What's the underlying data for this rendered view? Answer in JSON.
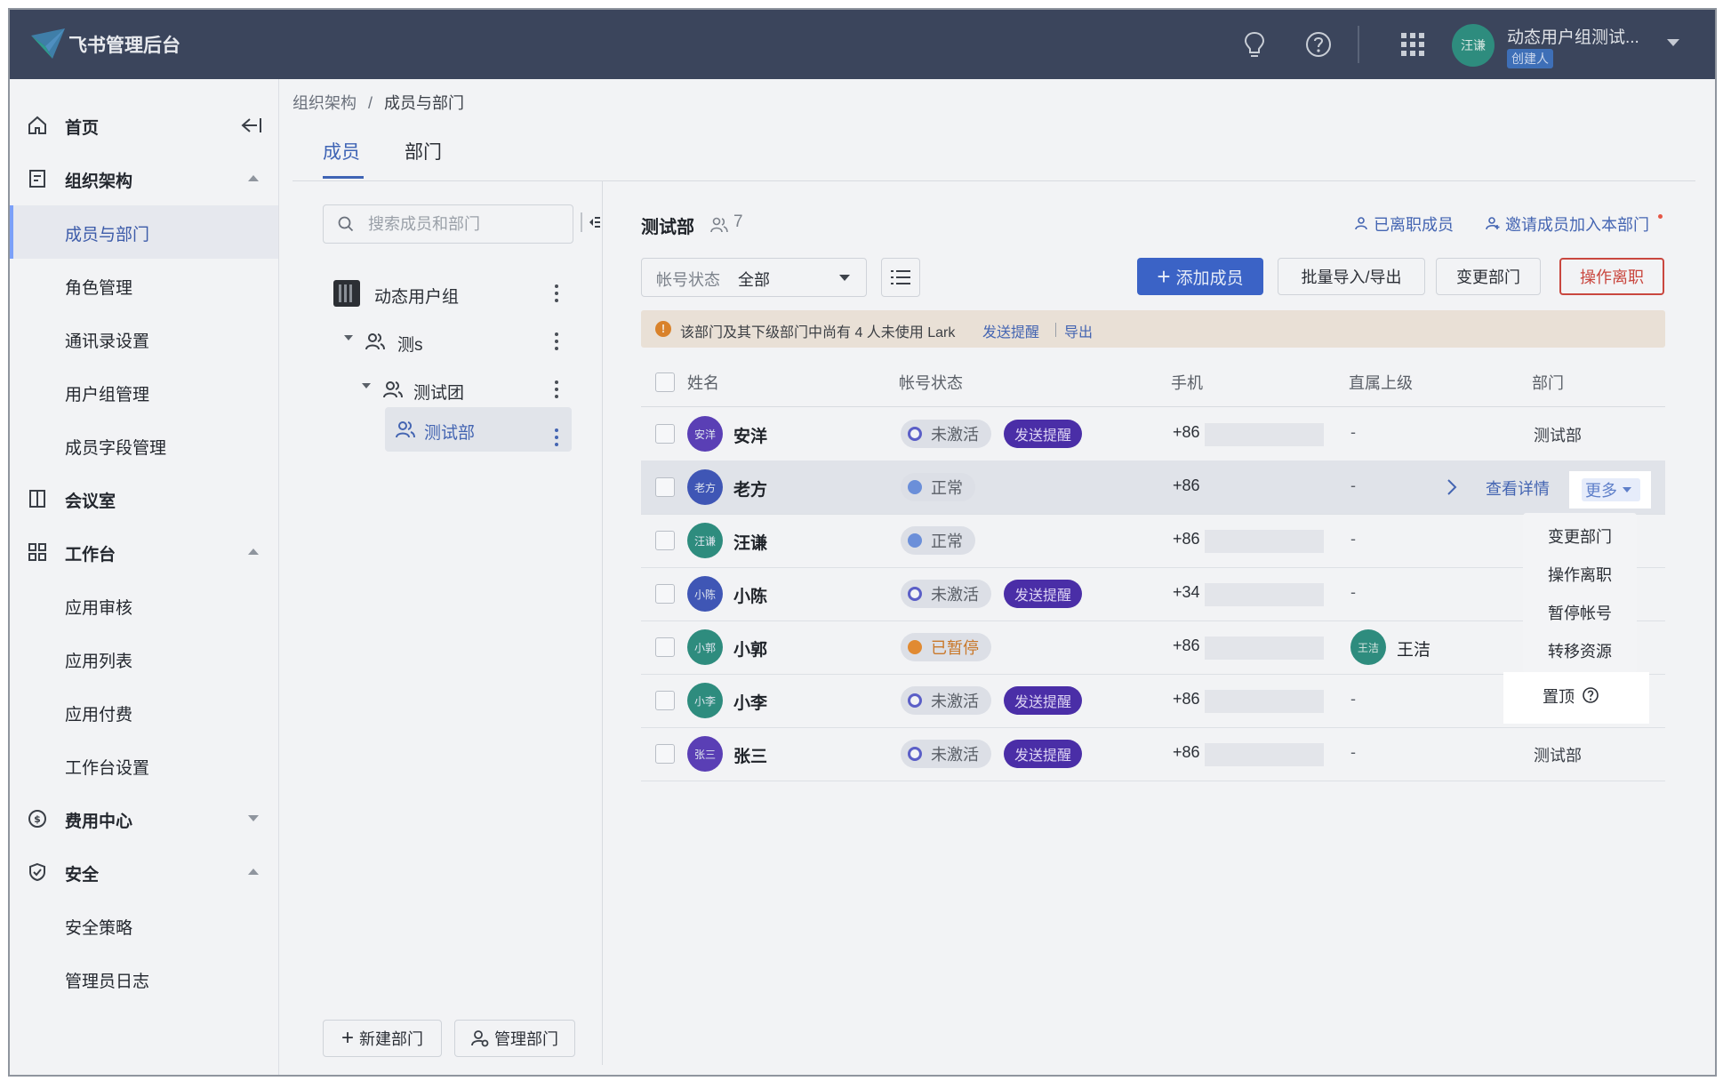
{
  "app": {
    "title": "飞书管理后台"
  },
  "topbar": {
    "user_name": "动态用户组测试...",
    "user_role": "创建人",
    "avatar_text": "汪谦"
  },
  "sidebar": {
    "items": [
      {
        "label": "首页",
        "icon": "home-icon"
      },
      {
        "label": "组织架构",
        "icon": "org-icon"
      },
      {
        "label": "成员与部门"
      },
      {
        "label": "角色管理"
      },
      {
        "label": "通讯录设置"
      },
      {
        "label": "用户组管理"
      },
      {
        "label": "成员字段管理"
      },
      {
        "label": "会议室",
        "icon": "meeting-room-icon"
      },
      {
        "label": "工作台",
        "icon": "workbench-icon"
      },
      {
        "label": "应用审核"
      },
      {
        "label": "应用列表"
      },
      {
        "label": "应用付费"
      },
      {
        "label": "工作台设置"
      },
      {
        "label": "费用中心",
        "icon": "billing-icon"
      },
      {
        "label": "安全",
        "icon": "security-icon"
      },
      {
        "label": "安全策略"
      },
      {
        "label": "管理员日志"
      }
    ]
  },
  "breadcrumb": {
    "root": "组织架构",
    "sep": "/",
    "current": "成员与部门"
  },
  "tabs": [
    {
      "label": "成员"
    },
    {
      "label": "部门"
    }
  ],
  "tree": {
    "search_placeholder": "搜索成员和部门",
    "nodes": [
      {
        "label": "动态用户组"
      },
      {
        "label": "测s"
      },
      {
        "label": "测试团"
      },
      {
        "label": "测试部"
      }
    ],
    "new_dept": "新建部门",
    "manage_dept": "管理部门"
  },
  "dept": {
    "title": "测试部",
    "count": "7",
    "left_members": "已离职成员",
    "invite": "邀请成员加入本部门"
  },
  "filter": {
    "label": "帐号状态",
    "value": "全部"
  },
  "actions": {
    "add": "添加成员",
    "import_export": "批量导入/导出",
    "change_dept": "变更部门",
    "resign": "操作离职"
  },
  "notice": {
    "text": "该部门及其下级部门中尚有 4 人未使用 Lark",
    "remind": "发送提醒",
    "export": "导出"
  },
  "table": {
    "headers": [
      "姓名",
      "帐号状态",
      "手机",
      "直属上级",
      "部门"
    ],
    "rows": [
      {
        "avatar": "安洋",
        "avatar_color": "#5a3fb5",
        "name": "安洋",
        "status": "未激活",
        "status_type": "inactive",
        "remind": "发送提醒",
        "phone": "+86",
        "manager": "-",
        "dept": "测试部"
      },
      {
        "avatar": "老方",
        "avatar_color": "#3f56b5",
        "name": "老方",
        "status": "正常",
        "status_type": "normal",
        "phone": "+86",
        "manager": "-",
        "detail": "查看详情",
        "more": "更多"
      },
      {
        "avatar": "汪谦",
        "avatar_color": "#2e8c7e",
        "name": "汪谦",
        "status": "正常",
        "status_type": "normal",
        "phone": "+86",
        "manager": "-"
      },
      {
        "avatar": "小陈",
        "avatar_color": "#3f56b5",
        "name": "小陈",
        "status": "未激活",
        "status_type": "inactive",
        "remind": "发送提醒",
        "phone": "+34",
        "manager": "-"
      },
      {
        "avatar": "小郭",
        "avatar_color": "#2e8c7e",
        "name": "小郭",
        "status": "已暂停",
        "status_type": "paused",
        "phone": "+86",
        "manager_avatar": "王洁",
        "manager": "王洁"
      },
      {
        "avatar": "小李",
        "avatar_color": "#2e8c7e",
        "name": "小李",
        "status": "未激活",
        "status_type": "inactive",
        "remind": "发送提醒",
        "phone": "+86",
        "manager": "-"
      },
      {
        "avatar": "张三",
        "avatar_color": "#5a3fb5",
        "name": "张三",
        "status": "未激活",
        "status_type": "inactive",
        "remind": "发送提醒",
        "phone": "+86",
        "manager": "-",
        "dept": "测试部"
      }
    ]
  },
  "more_menu": {
    "items": [
      "变更部门",
      "操作离职",
      "暂停帐号",
      "转移资源"
    ],
    "pin": "置顶"
  },
  "colors": {
    "primary": "#3b63c6",
    "danger": "#c9473f",
    "topbar": "#3b455c",
    "link": "#4465b2"
  }
}
